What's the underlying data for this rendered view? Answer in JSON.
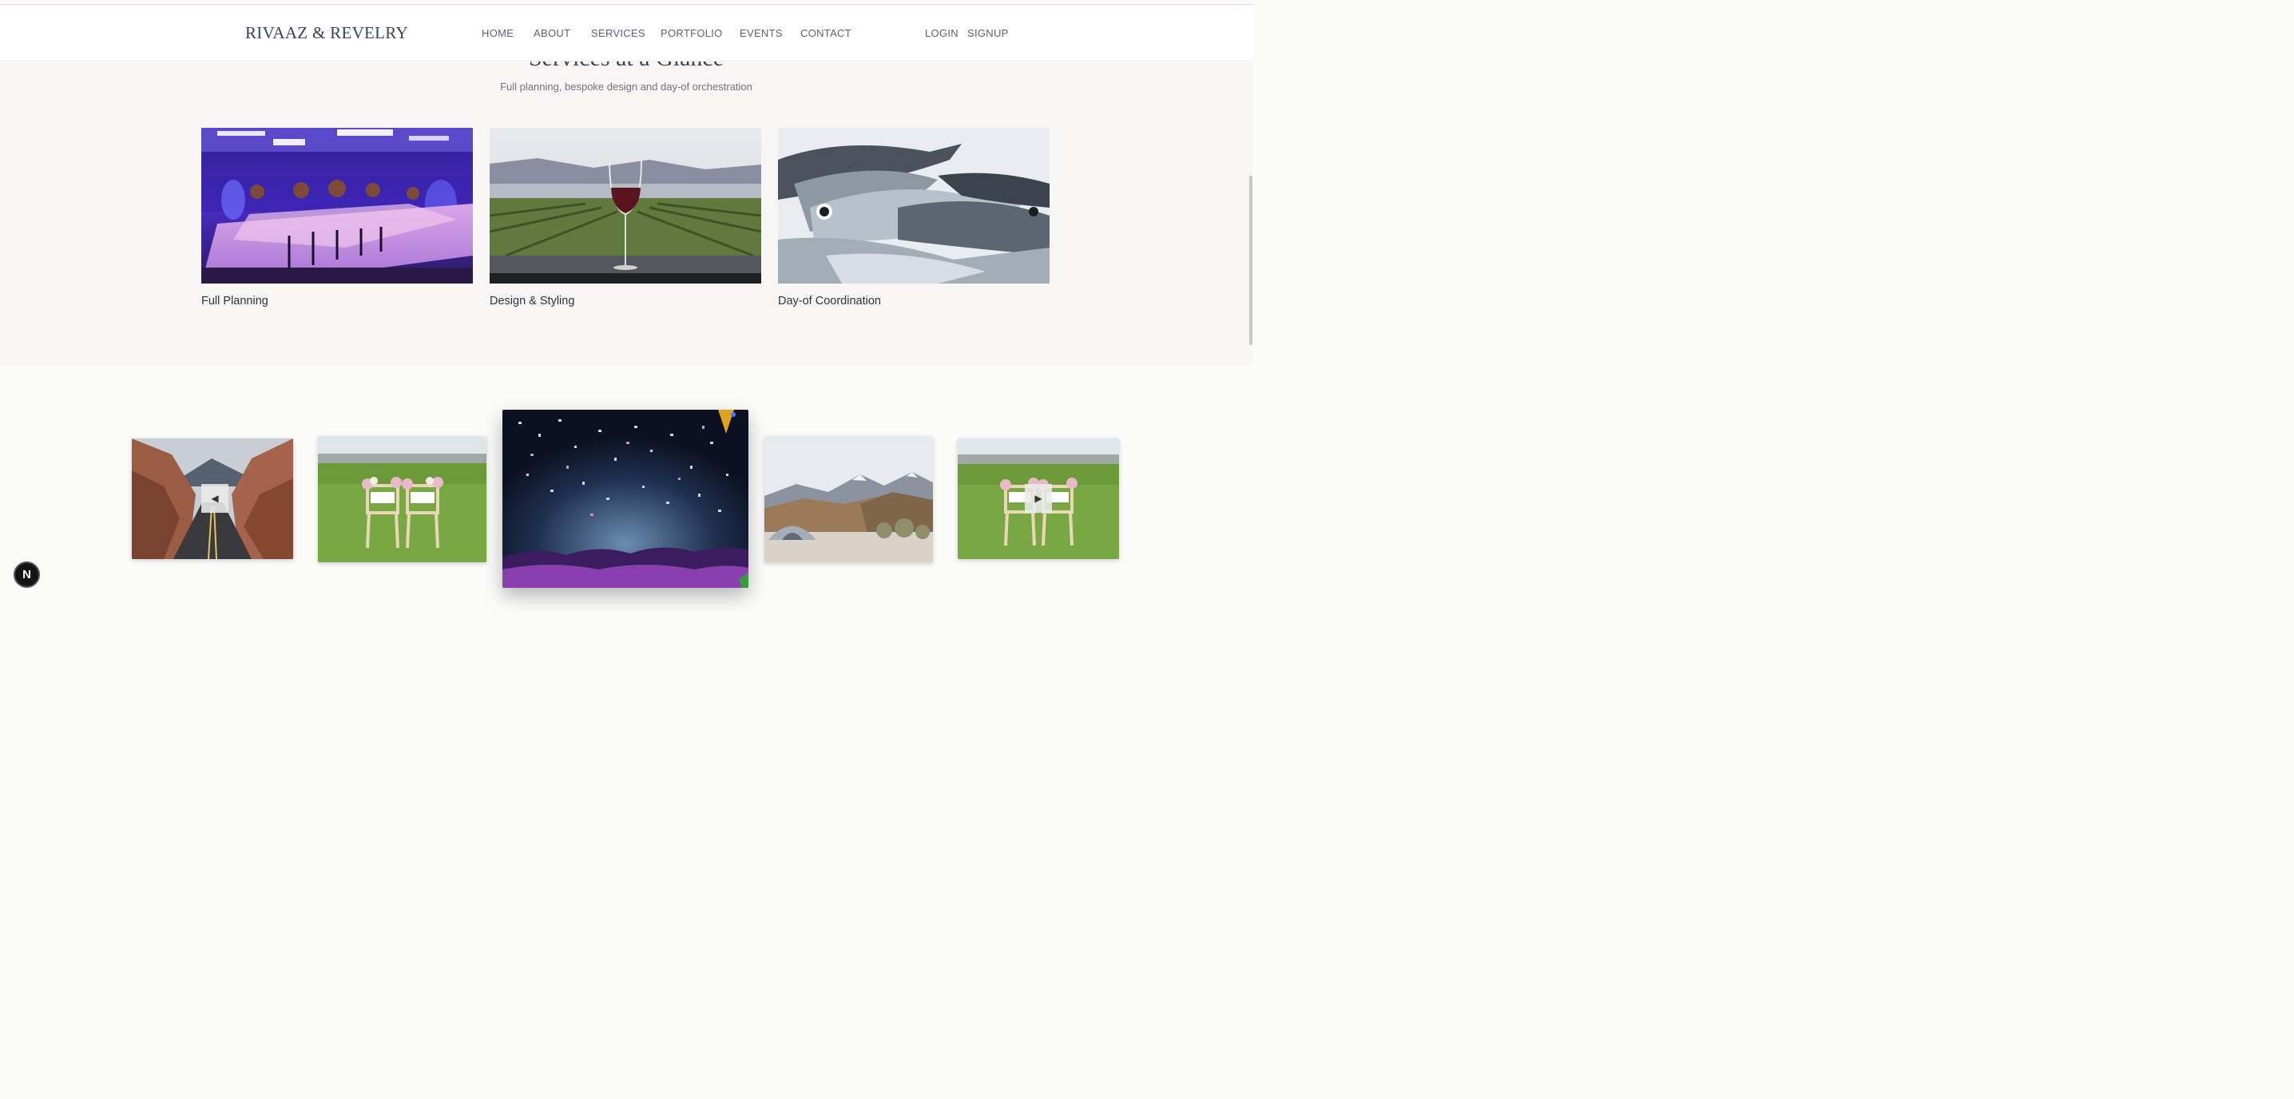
{
  "header": {
    "brand": "RIVAAZ & REVELRY",
    "nav": [
      "HOME",
      "ABOUT",
      "SERVICES",
      "PORTFOLIO",
      "EVENTS",
      "CONTACT"
    ],
    "auth": [
      "LOGIN",
      "SIGNUP"
    ]
  },
  "services": {
    "title": "Services at a Glance",
    "subtitle": "Full planning, bespoke design and day-of orchestration",
    "cards": [
      {
        "label": "Full Planning"
      },
      {
        "label": "Design & Styling"
      },
      {
        "label": "Day-of Coordination"
      }
    ]
  },
  "carousel": {
    "prev_icon": "◀",
    "next_icon": "▶"
  },
  "badge": {
    "letter": "N"
  }
}
